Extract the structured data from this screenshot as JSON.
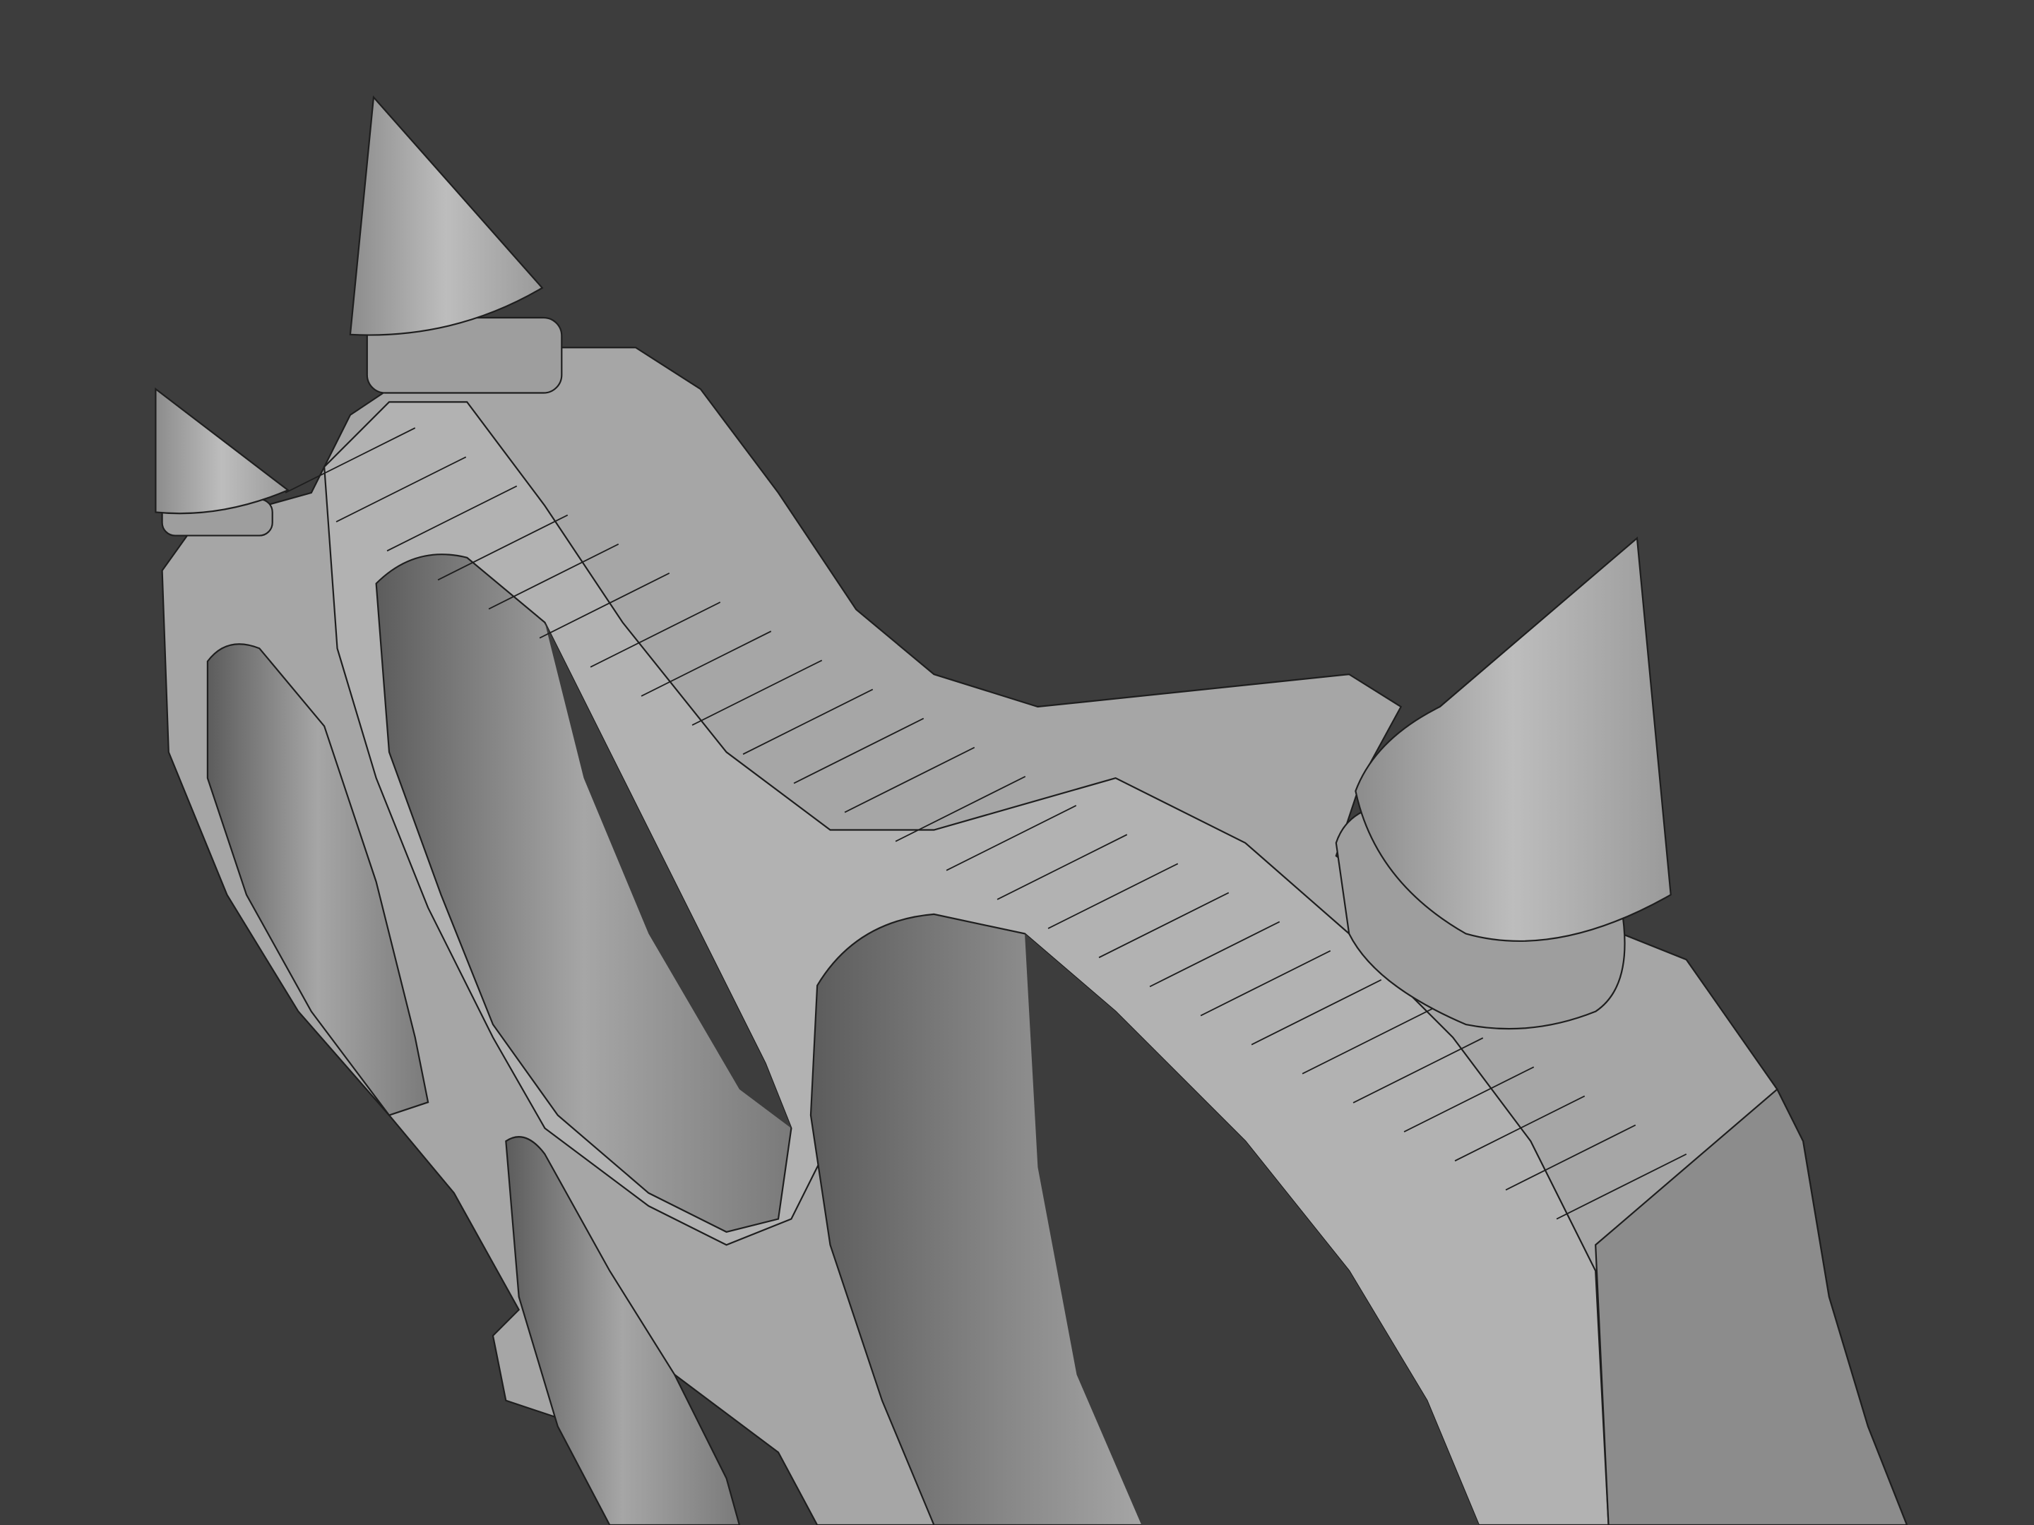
{
  "viewport": {
    "background": "#3d3d3d",
    "mesh_light": "#b4b4b4",
    "mesh_mid": "#a2a2a2",
    "mesh_dark": "#8a8a8a",
    "hole_shadow": "#6e6e6e",
    "wire": "#1e1e1e"
  }
}
